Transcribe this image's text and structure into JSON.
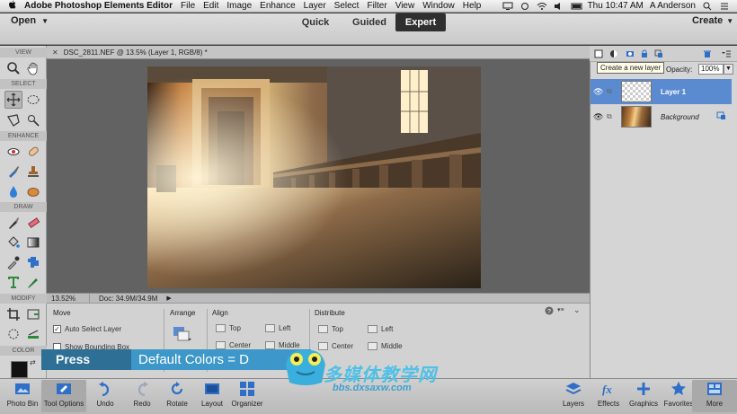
{
  "menubar": {
    "app_name": "Adobe Photoshop Elements Editor",
    "menus": [
      "File",
      "Edit",
      "Image",
      "Enhance",
      "Layer",
      "Select",
      "Filter",
      "View",
      "Window",
      "Help"
    ],
    "clock": "Thu 10:47 AM",
    "user": "A Anderson"
  },
  "modebar": {
    "open_label": "Open",
    "modes": [
      "Quick",
      "Guided",
      "Expert"
    ],
    "active_mode": "Expert",
    "create_label": "Create"
  },
  "toolbox": {
    "sections": [
      "VIEW",
      "SELECT",
      "ENHANCE",
      "DRAW",
      "MODIFY",
      "COLOR"
    ]
  },
  "document": {
    "tab_title": "DSC_2811.NEF @ 13.5% (Layer 1, RGB/8) *",
    "zoom": "13.52%",
    "doc_info": "Doc: 34.9M/34.9M"
  },
  "tool_options": {
    "move_title": "Move",
    "auto_select_label": "Auto Select Layer",
    "show_bounding_label": "Show Bounding Box",
    "arrange_title": "Arrange",
    "align_title": "Align",
    "align_items": [
      "Top",
      "Left",
      "Center",
      "Middle"
    ],
    "distribute_title": "Distribute",
    "distribute_items": [
      "Top",
      "Left",
      "Center",
      "Middle"
    ]
  },
  "layers_panel": {
    "tooltip": "Create a new layer",
    "opacity_label": "Opacity:",
    "opacity_value": "100%",
    "layers": [
      {
        "name": "Layer 1",
        "selected": true
      },
      {
        "name": "Background",
        "selected": false
      }
    ]
  },
  "bottombar": {
    "left_buttons": [
      "Photo Bin",
      "Tool Options",
      "Undo",
      "Redo",
      "Rotate",
      "Layout",
      "Organizer"
    ],
    "right_buttons": [
      "Layers",
      "Effects",
      "Graphics",
      "Favorites",
      "More"
    ]
  },
  "overlay": {
    "press_word": "Press",
    "press_text": "Default Colors = D",
    "watermark_text": "多媒体教学网",
    "watermark_url": "bbs.dxsaxw.com"
  },
  "colors": {
    "accent_blue": "#5a8bd0",
    "expert_tab": "#2f2f2f",
    "overlay_dark": "#2d6f95",
    "overlay_light": "#3d97c9"
  }
}
